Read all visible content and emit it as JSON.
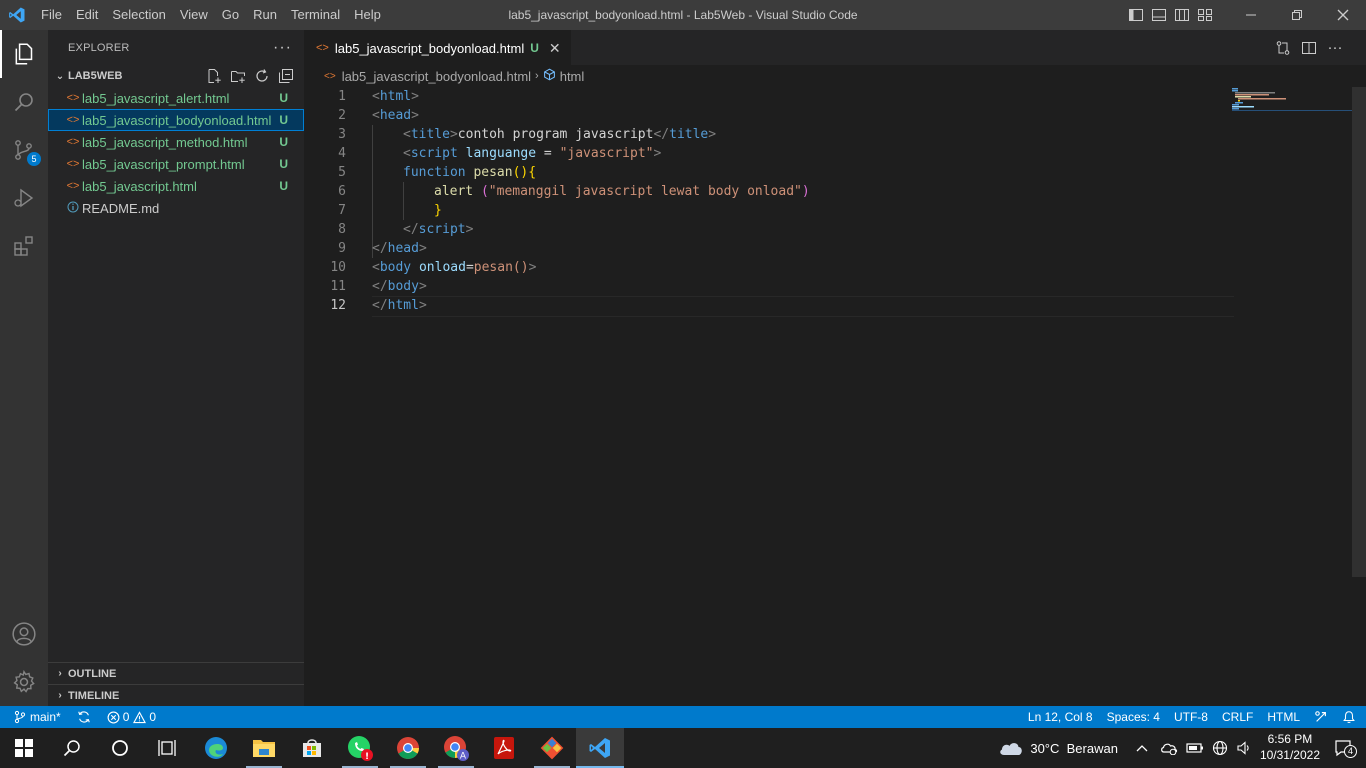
{
  "window": {
    "title": "lab5_javascript_bodyonload.html - Lab5Web - Visual Studio Code",
    "menu": [
      "File",
      "Edit",
      "Selection",
      "View",
      "Go",
      "Run",
      "Terminal",
      "Help"
    ]
  },
  "activitybar": {
    "source_control_badge": "5"
  },
  "sidebar": {
    "title": "EXPLORER",
    "more": "···",
    "folder": "LAB5WEB",
    "files": [
      {
        "name": "lab5_javascript_alert.html",
        "status": "U"
      },
      {
        "name": "lab5_javascript_bodyonload.html",
        "status": "U"
      },
      {
        "name": "lab5_javascript_method.html",
        "status": "U"
      },
      {
        "name": "lab5_javascript_prompt.html",
        "status": "U"
      },
      {
        "name": "lab5_javascript.html",
        "status": "U"
      },
      {
        "name": "README.md",
        "status": ""
      }
    ],
    "outline": "OUTLINE",
    "timeline": "TIMELINE"
  },
  "editor": {
    "tab": {
      "label": "lab5_javascript_bodyonload.html",
      "status": "U",
      "close": "✕"
    },
    "breadcrumb": {
      "file": "lab5_javascript_bodyonload.html",
      "symbol": "html"
    },
    "line_numbers": [
      "1",
      "2",
      "3",
      "4",
      "5",
      "6",
      "7",
      "8",
      "9",
      "10",
      "11",
      "12"
    ],
    "code": {
      "l1": [
        "<",
        "html",
        ">"
      ],
      "l2": [
        "<",
        "head",
        ">"
      ],
      "l3": [
        "<",
        "title",
        ">",
        "contoh program javascript",
        "</",
        "title",
        ">"
      ],
      "l4": [
        "<",
        "script",
        " ",
        "languange",
        " = ",
        "\"javascript\"",
        ">"
      ],
      "l5": [
        "function",
        " ",
        "pesan",
        "(",
        ")",
        "{"
      ],
      "l6": [
        "alert",
        " ",
        "(",
        "\"memanggil javascript lewat body onload\"",
        ")"
      ],
      "l7": [
        "}"
      ],
      "l8": [
        "</",
        "script",
        ">"
      ],
      "l9": [
        "</",
        "head",
        ">"
      ],
      "l10": [
        "<",
        "body",
        " ",
        "onload",
        "=",
        "pesan",
        "()",
        ">"
      ],
      "l11": [
        "</",
        "body",
        ">"
      ],
      "l12": [
        "</",
        "html",
        ">"
      ]
    }
  },
  "statusbar": {
    "branch": "main*",
    "errors": "0",
    "warnings": "0",
    "position": "Ln 12, Col 8",
    "spaces": "Spaces: 4",
    "encoding": "UTF-8",
    "eol": "CRLF",
    "language": "HTML"
  },
  "taskbar": {
    "weather": "30°C  Berawan",
    "time": "6:56 PM",
    "date": "10/31/2022",
    "notifications": "4"
  },
  "colors": {
    "statusbar": "#007acc",
    "untracked": "#73c991",
    "selection": "#04395e"
  }
}
